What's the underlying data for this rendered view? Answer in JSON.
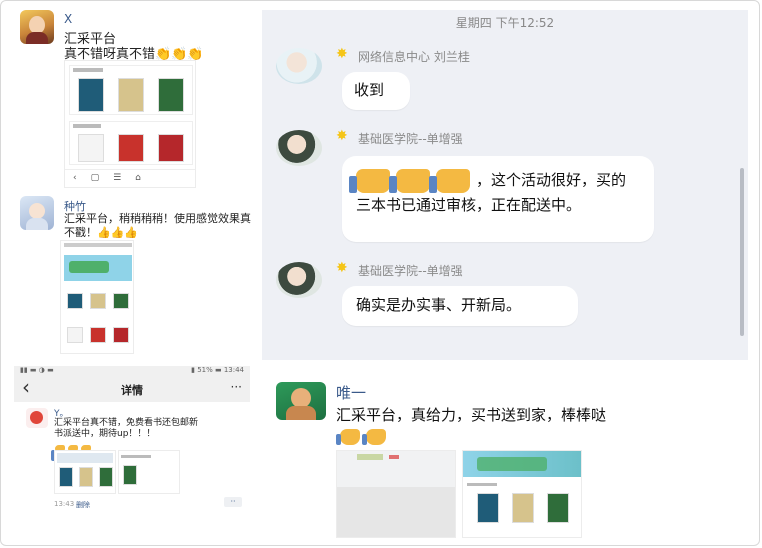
{
  "colors": {
    "chat_bg": "#eef0f5",
    "accent_green": "#2e9a5a",
    "name_blue": "#3a5a8a",
    "star": "#f5c518"
  },
  "post1": {
    "name": "X",
    "line1": "汇采平台",
    "line2": "真不错呀真不错👏👏👏"
  },
  "post2": {
    "name": "种竹",
    "text": "汇采平台，稍稍稍稍！使用感觉效果真不戳！👍👍👍"
  },
  "chat": {
    "timestamp": "星期四 下午12:52",
    "messages": [
      {
        "name": "网络信息中心  刘兰桂",
        "text": "收到"
      },
      {
        "name": "基础医学院--单增强",
        "text": "，这个活动很好，买的三本书已通过审核，正在配送中。"
      },
      {
        "name": "基础医学院--单增强",
        "text": "确实是办实事、开新局。"
      }
    ]
  },
  "detail": {
    "status_left": "▮▮ ▬ ◑ ▬",
    "status_right": "▮ 51% ▬ 13:44",
    "back_icon": "‹",
    "title": "详情",
    "more": "···",
    "user": "Y。",
    "text": "汇采平台真不错，免费看书还包邮新书派送中，期待up！！！",
    "time": "13:43",
    "delete": "删除",
    "dots": "··"
  },
  "post4": {
    "name": "唯一",
    "text": "汇采平台，真给力，买书送到家，棒棒哒"
  }
}
